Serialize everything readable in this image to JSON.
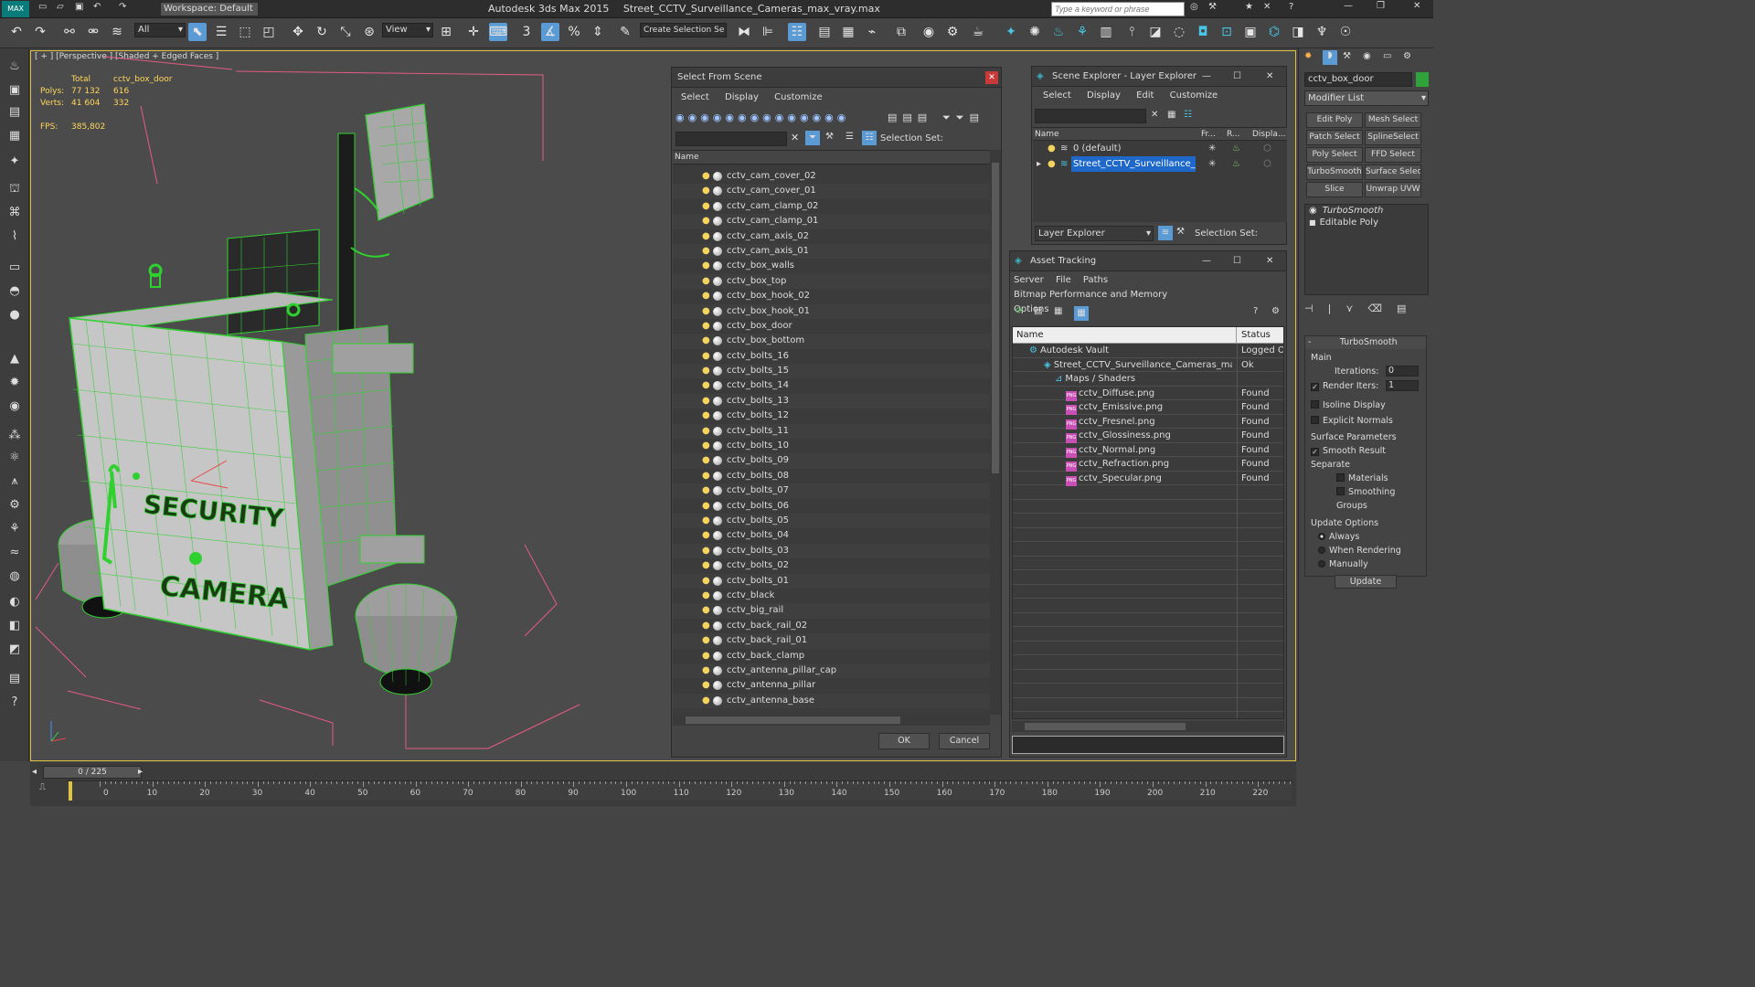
{
  "app": {
    "title": "Autodesk 3ds Max 2015",
    "file": "Street_CCTV_Surveillance_Cameras_max_vray.max",
    "workspace": "Workspace: Default",
    "search_placeholder": "Type a keyword or phrase"
  },
  "toolbar": {
    "filter": "All",
    "view": "View",
    "snap_label": "3",
    "selection_set": "Create Selection Se"
  },
  "viewport": {
    "label": "[ + ] [Perspective ] [Shaded + Edged Faces ]",
    "stats": {
      "total_label": "Total",
      "object_label": "cctv_box_door",
      "polys_label": "Polys:",
      "polys_total": "77 132",
      "polys_object": "616",
      "verts_label": "Verts:",
      "verts_total": "41 604",
      "verts_object": "332",
      "fps_label": "FPS:",
      "fps_value": "385,802"
    },
    "box_text_1": "SECURITY",
    "box_text_2": "CAMERA"
  },
  "select_dialog": {
    "title": "Select From Scene",
    "menu": [
      "Select",
      "Display",
      "Customize"
    ],
    "selection_set_label": "Selection Set:",
    "column_name": "Name",
    "items": [
      "cctv_cam_cover_02",
      "cctv_cam_cover_01",
      "cctv_cam_clamp_02",
      "cctv_cam_clamp_01",
      "cctv_cam_axis_02",
      "cctv_cam_axis_01",
      "cctv_box_walls",
      "cctv_box_top",
      "cctv_box_hook_02",
      "cctv_box_hook_01",
      "cctv_box_door",
      "cctv_box_bottom",
      "cctv_bolts_16",
      "cctv_bolts_15",
      "cctv_bolts_14",
      "cctv_bolts_13",
      "cctv_bolts_12",
      "cctv_bolts_11",
      "cctv_bolts_10",
      "cctv_bolts_09",
      "cctv_bolts_08",
      "cctv_bolts_07",
      "cctv_bolts_06",
      "cctv_bolts_05",
      "cctv_bolts_04",
      "cctv_bolts_03",
      "cctv_bolts_02",
      "cctv_bolts_01",
      "cctv_black",
      "cctv_big_rail",
      "cctv_back_rail_02",
      "cctv_back_rail_01",
      "cctv_back_clamp",
      "cctv_antenna_pillar_cap",
      "cctv_antenna_pillar",
      "cctv_antenna_base"
    ],
    "ok": "OK",
    "cancel": "Cancel"
  },
  "scene_explorer": {
    "title": "Scene Explorer - Layer Explorer",
    "menu": [
      "Select",
      "Display",
      "Edit",
      "Customize"
    ],
    "columns": [
      "Name",
      "Fr...",
      "R...",
      "Displa..."
    ],
    "layers": [
      "0 (default)",
      "Street_CCTV_Surveillance_Cam..."
    ],
    "footer_dropdown": "Layer Explorer",
    "footer_selection": "Selection Set:"
  },
  "asset_tracking": {
    "title": "Asset Tracking",
    "menu": [
      "Server",
      "File",
      "Paths",
      "Bitmap Performance and Memory"
    ],
    "menu2": "Options",
    "columns": [
      "Name",
      "Status"
    ],
    "vault": {
      "name": "Autodesk Vault",
      "status": "Logged Ou"
    },
    "file": {
      "name": "Street_CCTV_Surveillance_Cameras_max_vr...",
      "status": "Ok"
    },
    "folder": "Maps / Shaders",
    "maps": [
      {
        "name": "cctv_Diffuse.png",
        "status": "Found"
      },
      {
        "name": "cctv_Emissive.png",
        "status": "Found"
      },
      {
        "name": "cctv_Fresnel.png",
        "status": "Found"
      },
      {
        "name": "cctv_Glossiness.png",
        "status": "Found"
      },
      {
        "name": "cctv_Normal.png",
        "status": "Found"
      },
      {
        "name": "cctv_Refraction.png",
        "status": "Found"
      },
      {
        "name": "cctv_Specular.png",
        "status": "Found"
      }
    ]
  },
  "command_panel": {
    "object_name": "cctv_box_door",
    "modifier_list": "Modifier List",
    "buttons": [
      "Edit Poly",
      "Mesh Select",
      "Patch Select",
      "SplineSelect",
      "Poly Select",
      "FFD Select",
      "TurboSmooth",
      "Surface Select",
      "Slice",
      "Unwrap UVW"
    ],
    "stack": [
      "TurboSmooth",
      "Editable Poly"
    ],
    "rollout_title": "TurboSmooth",
    "main_label": "Main",
    "iterations_label": "Iterations:",
    "iterations_value": "0",
    "render_iters_label": "Render Iters:",
    "render_iters_value": "1",
    "isoline": "Isoline Display",
    "explicit_normals": "Explicit Normals",
    "surface_params": "Surface Parameters",
    "smooth_result": "Smooth Result",
    "separate": "Separate",
    "materials": "Materials",
    "smoothing_groups": "Smoothing Groups",
    "update_options": "Update Options",
    "always": "Always",
    "when_rendering": "When Rendering",
    "manually": "Manually",
    "update_button": "Update"
  },
  "timeline": {
    "frame": "0 / 225",
    "ticks": [
      "0",
      "10",
      "20",
      "30",
      "40",
      "50",
      "60",
      "70",
      "80",
      "90",
      "100",
      "110",
      "120",
      "130",
      "140",
      "150",
      "160",
      "170",
      "180",
      "190",
      "200",
      "210",
      "220"
    ]
  },
  "colors": {
    "accent": "#5b9bd5",
    "wire": "#2fd12f",
    "selection": "#1e68c9",
    "viewport_border": "#e1c340"
  }
}
